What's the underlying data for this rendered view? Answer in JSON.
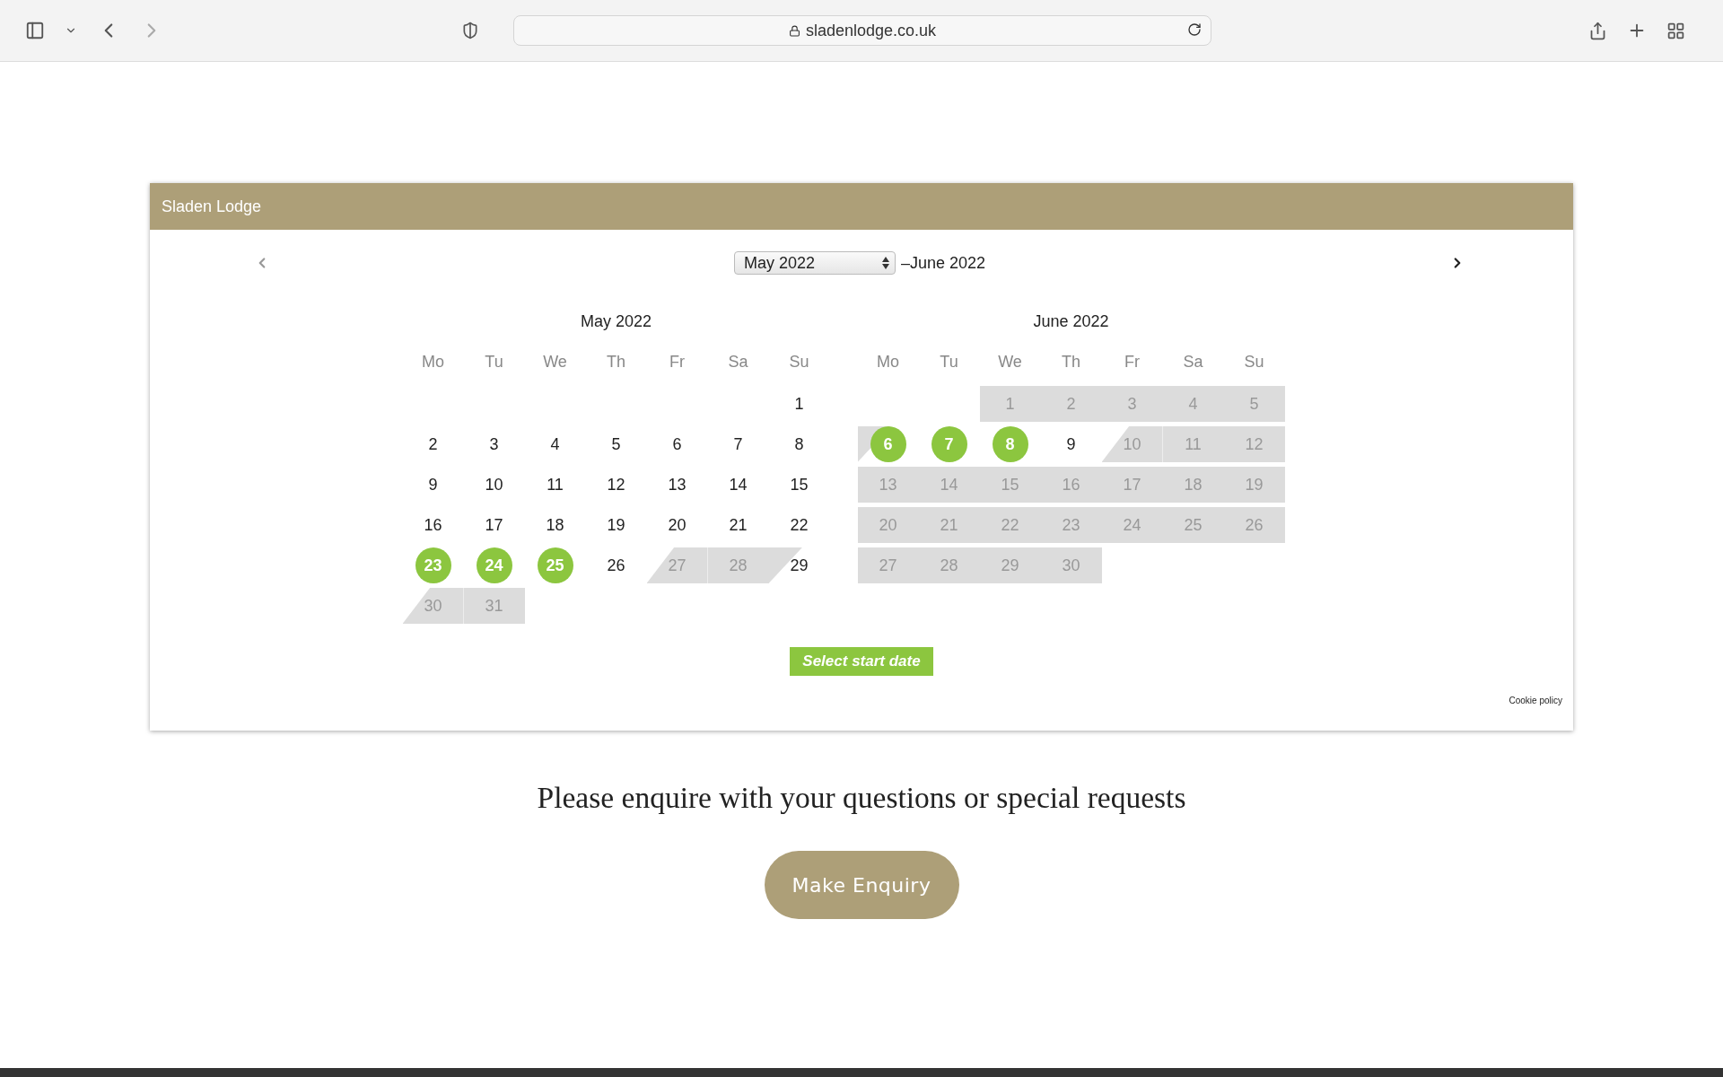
{
  "browser": {
    "url": "sladenlodge.co.uk"
  },
  "widget": {
    "title": "Sladen Lodge",
    "select": {
      "value": "May 2022"
    },
    "range_end": "–June 2022",
    "months": [
      {
        "title": "May 2022",
        "weekdays": [
          "Mo",
          "Tu",
          "We",
          "Th",
          "Fr",
          "Sa",
          "Su"
        ],
        "weeks": [
          [
            {
              "kind": "blank"
            },
            {
              "kind": "blank"
            },
            {
              "kind": "blank"
            },
            {
              "kind": "blank"
            },
            {
              "kind": "blank"
            },
            {
              "kind": "blank"
            },
            {
              "day": "1",
              "kind": "free",
              "highlight": false
            }
          ],
          [
            {
              "day": "2",
              "kind": "free",
              "highlight": false
            },
            {
              "day": "3",
              "kind": "free",
              "highlight": false
            },
            {
              "day": "4",
              "kind": "free",
              "highlight": false
            },
            {
              "day": "5",
              "kind": "free",
              "highlight": false
            },
            {
              "day": "6",
              "kind": "free",
              "highlight": false
            },
            {
              "day": "7",
              "kind": "free",
              "highlight": false
            },
            {
              "day": "8",
              "kind": "free",
              "highlight": false
            }
          ],
          [
            {
              "day": "9",
              "kind": "free",
              "highlight": false
            },
            {
              "day": "10",
              "kind": "free",
              "highlight": false
            },
            {
              "day": "11",
              "kind": "free",
              "highlight": false
            },
            {
              "day": "12",
              "kind": "free",
              "highlight": false
            },
            {
              "day": "13",
              "kind": "free",
              "highlight": false
            },
            {
              "day": "14",
              "kind": "free",
              "highlight": false
            },
            {
              "day": "15",
              "kind": "free",
              "highlight": false
            }
          ],
          [
            {
              "day": "16",
              "kind": "free",
              "highlight": false
            },
            {
              "day": "17",
              "kind": "free",
              "highlight": false
            },
            {
              "day": "18",
              "kind": "free",
              "highlight": false
            },
            {
              "day": "19",
              "kind": "free",
              "highlight": false
            },
            {
              "day": "20",
              "kind": "free",
              "highlight": false
            },
            {
              "day": "21",
              "kind": "free",
              "highlight": false
            },
            {
              "day": "22",
              "kind": "free",
              "highlight": false
            }
          ],
          [
            {
              "day": "23",
              "kind": "free",
              "highlight": true
            },
            {
              "day": "24",
              "kind": "free",
              "highlight": true
            },
            {
              "day": "25",
              "kind": "free",
              "highlight": true
            },
            {
              "day": "26",
              "kind": "free",
              "highlight": false
            },
            {
              "day": "27",
              "kind": "arrive",
              "highlight": false
            },
            {
              "day": "28",
              "kind": "booked",
              "highlight": false
            },
            {
              "day": "29",
              "kind": "depart",
              "highlight": false
            }
          ],
          [
            {
              "day": "30",
              "kind": "arrive",
              "highlight": false
            },
            {
              "day": "31",
              "kind": "booked",
              "highlight": false
            }
          ]
        ]
      },
      {
        "title": "June 2022",
        "weekdays": [
          "Mo",
          "Tu",
          "We",
          "Th",
          "Fr",
          "Sa",
          "Su"
        ],
        "weeks": [
          [
            {
              "kind": "blank"
            },
            {
              "kind": "blank"
            },
            {
              "day": "1",
              "kind": "booked",
              "highlight": false
            },
            {
              "day": "2",
              "kind": "booked",
              "highlight": false
            },
            {
              "day": "3",
              "kind": "booked",
              "highlight": false
            },
            {
              "day": "4",
              "kind": "booked",
              "highlight": false
            },
            {
              "day": "5",
              "kind": "booked",
              "highlight": false
            }
          ],
          [
            {
              "day": "6",
              "kind": "depart",
              "highlight": true
            },
            {
              "day": "7",
              "kind": "free",
              "highlight": true
            },
            {
              "day": "8",
              "kind": "free",
              "highlight": true
            },
            {
              "day": "9",
              "kind": "free",
              "highlight": false
            },
            {
              "day": "10",
              "kind": "arrive",
              "highlight": false
            },
            {
              "day": "11",
              "kind": "booked",
              "highlight": false
            },
            {
              "day": "12",
              "kind": "booked",
              "highlight": false
            }
          ],
          [
            {
              "day": "13",
              "kind": "booked",
              "highlight": false
            },
            {
              "day": "14",
              "kind": "booked",
              "highlight": false
            },
            {
              "day": "15",
              "kind": "booked",
              "highlight": false
            },
            {
              "day": "16",
              "kind": "booked",
              "highlight": false
            },
            {
              "day": "17",
              "kind": "booked",
              "highlight": false
            },
            {
              "day": "18",
              "kind": "booked",
              "highlight": false
            },
            {
              "day": "19",
              "kind": "booked",
              "highlight": false
            }
          ],
          [
            {
              "day": "20",
              "kind": "booked",
              "highlight": false
            },
            {
              "day": "21",
              "kind": "booked",
              "highlight": false
            },
            {
              "day": "22",
              "kind": "booked",
              "highlight": false
            },
            {
              "day": "23",
              "kind": "booked",
              "highlight": false
            },
            {
              "day": "24",
              "kind": "booked",
              "highlight": false
            },
            {
              "day": "25",
              "kind": "booked",
              "highlight": false
            },
            {
              "day": "26",
              "kind": "booked",
              "highlight": false
            }
          ],
          [
            {
              "day": "27",
              "kind": "booked",
              "highlight": false
            },
            {
              "day": "28",
              "kind": "booked",
              "highlight": false
            },
            {
              "day": "29",
              "kind": "booked",
              "highlight": false
            },
            {
              "day": "30",
              "kind": "booked",
              "highlight": false
            }
          ]
        ]
      }
    ],
    "button": "Select start date",
    "cookie_link": "Cookie policy"
  },
  "enquiry": {
    "text": "Please enquire with your questions or special requests",
    "button": "Make Enquiry"
  }
}
